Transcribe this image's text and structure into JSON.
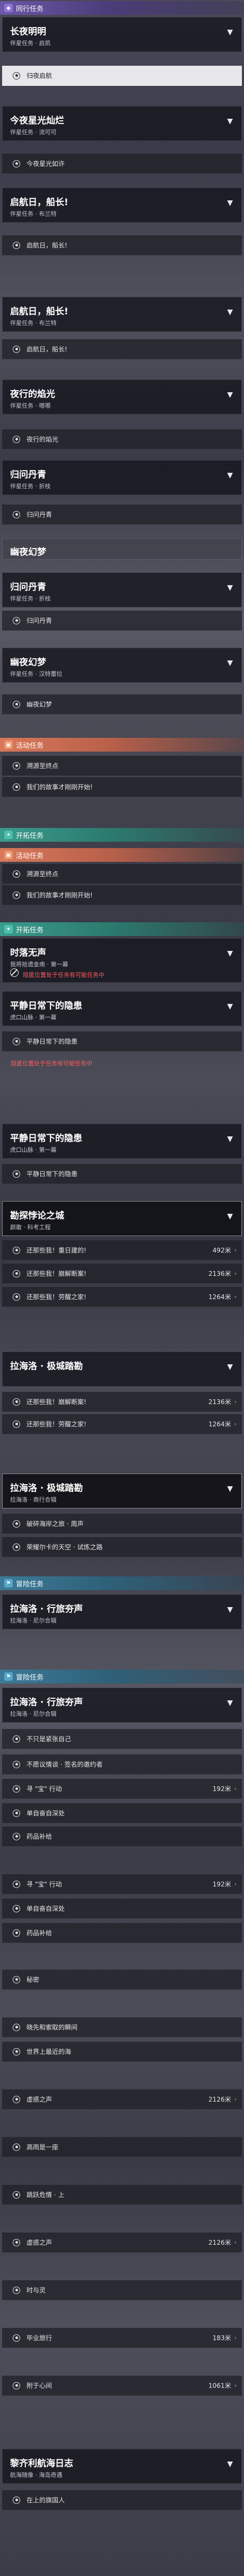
{
  "sections": {
    "companion": "同行任务",
    "event": "活动任务",
    "trailblaze": "开拓任务",
    "adventure": "冒险任务"
  },
  "cards": [
    {
      "title": "长夜明明",
      "subtitle": "伴星任务 · 启凯"
    },
    {
      "title": "今夜星光灿烂",
      "subtitle": "伴星任务 · 流可可"
    },
    {
      "title": "启航日，船长!",
      "subtitle": "伴星任务 · 布兰特"
    },
    {
      "title": "启航日，船长!",
      "subtitle": "伴星任务 · 布兰特"
    },
    {
      "title": "夜行的焰光",
      "subtitle": "伴星任务 · 嗯哪"
    },
    {
      "title": "归问丹青",
      "subtitle": "伴星任务 · 折枝"
    },
    {
      "title": "幽夜幻梦",
      "subtitle": ""
    },
    {
      "title": "归问丹青",
      "subtitle": "伴星任务 · 折枝"
    },
    {
      "title": "幽夜幻梦",
      "subtitle": "伴星任务 · 汉特蕾拉"
    },
    {
      "title": "时落无声",
      "subtitle": "我将拾遗金南 · 第一幕"
    },
    {
      "title": "平静日常下的隐患",
      "subtitle": "虎口山脉 · 第一幕"
    },
    {
      "title": "平静日常下的隐患",
      "subtitle": "虎口山脉 · 第一幕"
    },
    {
      "title": "勘探悖论之城",
      "subtitle": "颜敢 · 科考工程"
    },
    {
      "title": "拉海洛 · 极城踏勘",
      "subtitle": ""
    },
    {
      "title": "拉海洛 · 极城踏勘",
      "subtitle": "拉海洛 · 商行合辑"
    },
    {
      "title": "拉海洛 · 行旅夯声",
      "subtitle": "拉海洛 · 尼尔合辑"
    },
    {
      "title": "拉海洛 · 行旅夯声",
      "subtitle": "拉海洛 · 尼尔合辑"
    },
    {
      "title": "黎齐利航海日志",
      "subtitle": "航海随像 · 海岛奇遇"
    }
  ],
  "rows": [
    "归夜启航",
    "今夜星光如许",
    "启航日，船长!",
    "启航日，船长!",
    "夜行的焰光",
    "归问丹青",
    "归问丹青",
    "幽夜幻梦",
    "溯源至终点",
    "我们的故事才刚刚开始!",
    "溯源至终点",
    "我们的故事才刚刚开始!",
    "平静日常下的隐患",
    "平静日常下的隐患",
    "还那些我！重日建的!",
    "还那些我！崩解断案!",
    "还那些我！劳醒之家!",
    "还那些我！崩解断案!",
    "还那些我！劳醒之家!",
    "破碎海岸之旅 · 周声",
    "荣耀尔卡的天空 · 试炼之路",
    "不只是紧张自己",
    "不愿议情谈 · 签名的邀约者",
    "寻 \"宝\" 行动",
    "单自奋自深处",
    "药品补给",
    "寻 \"宝\" 行动",
    "单自奋自深处",
    "药品补给",
    "秘密",
    "晓先和索取的瞬间",
    "世界上最近的海",
    "虚惑之声",
    "高雨是一座",
    "跳跃危情 · 上",
    "虚惑之声",
    "时与灵",
    "毕业旅行",
    "附于心间",
    "在上的旗国人"
  ],
  "values": {
    "v492": "492米",
    "v2136": "2136米",
    "v1264": "1264米",
    "v192": "192米",
    "v2126": "2126米",
    "v183": "183米",
    "v1061": "1061米"
  },
  "warnings": {
    "lost": "隐匿位置处于任务有可能任务中",
    "lost2": "隐匿位置处于任务有可能任务中"
  },
  "icons": {
    "companion": "diamond-icon",
    "event": "calendar-icon",
    "trailblaze": "compass-icon",
    "adventure": "flag-icon"
  }
}
